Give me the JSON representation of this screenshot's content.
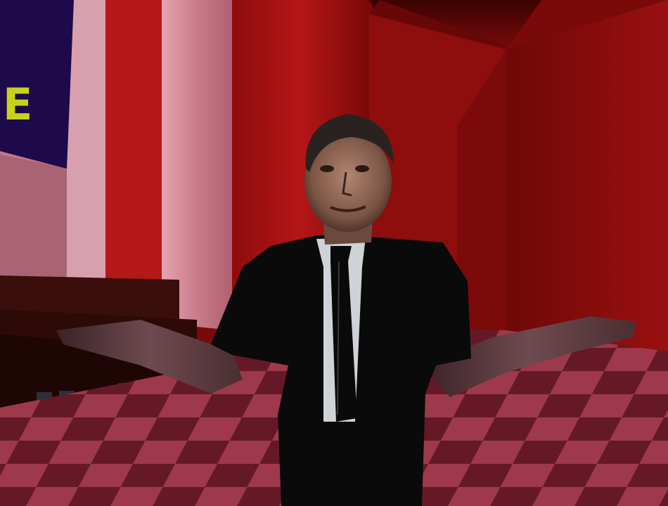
{
  "banner": {
    "text": "E",
    "background": "#1e0a4a",
    "text_color": "#c8d21a"
  },
  "colors": {
    "wall_red": "#a01212",
    "wall_dark": "#5a0808",
    "floor_light": "#b8485e",
    "floor_dark": "#6e1e2e",
    "pillar": "#d08a98",
    "suit": "#0a0a0a",
    "shirt": "#cfd2d6"
  },
  "character": {
    "name": ""
  }
}
